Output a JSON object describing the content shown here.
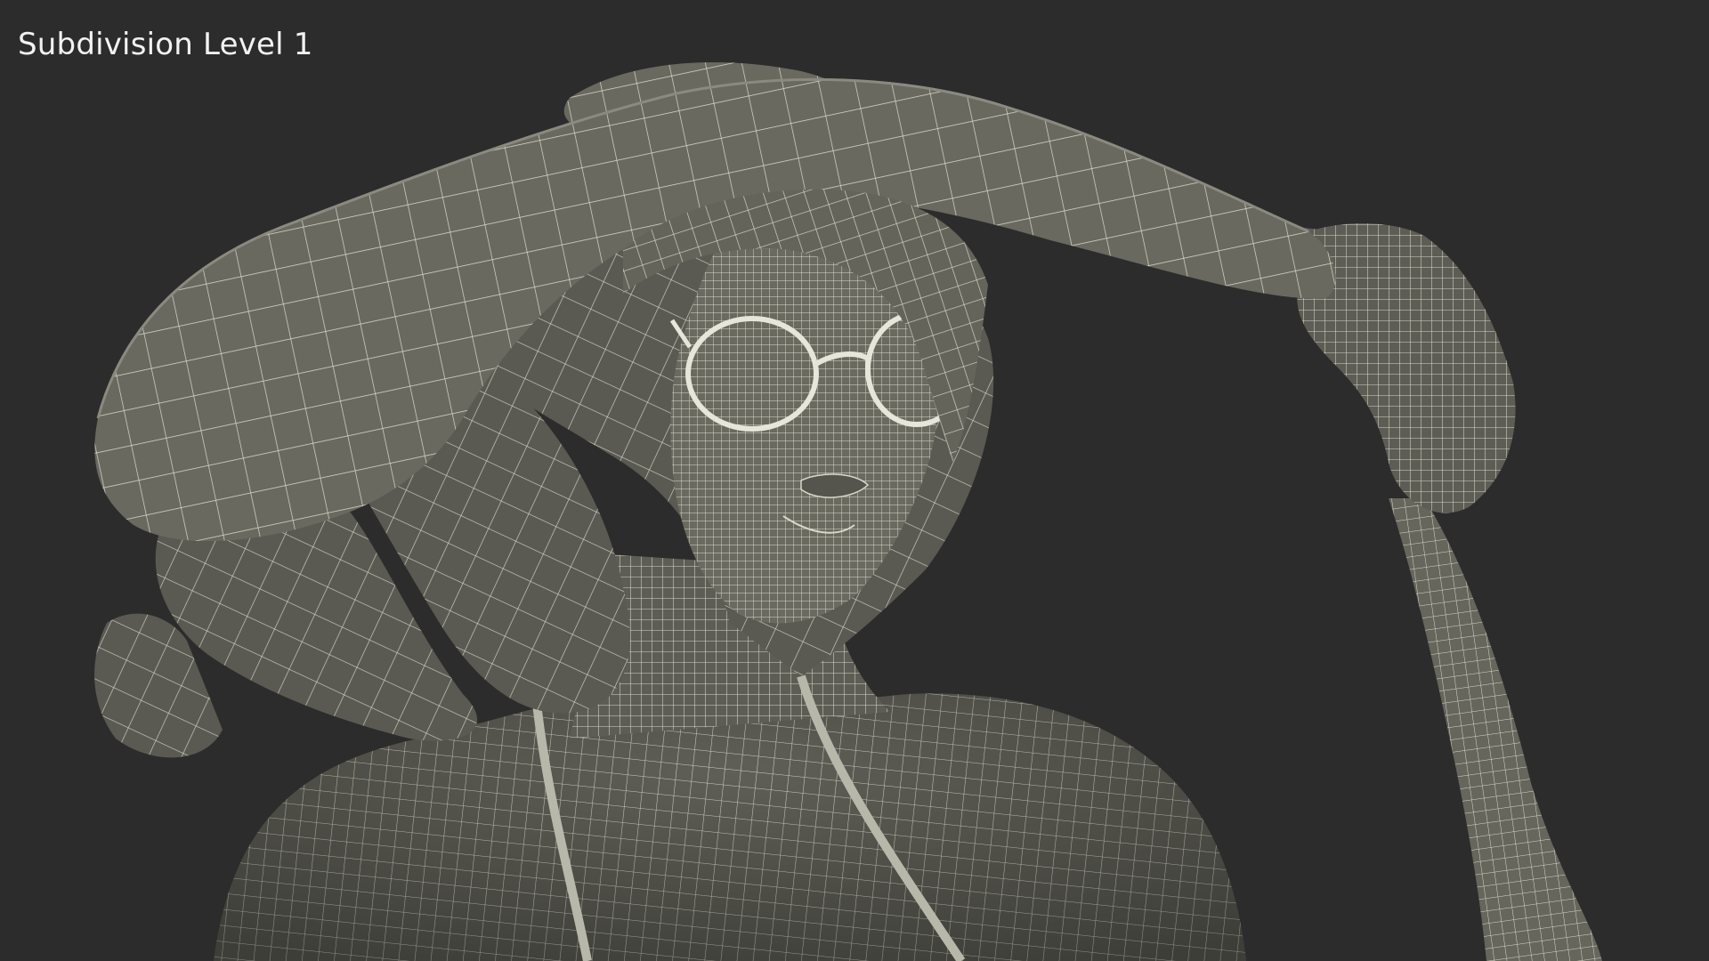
{
  "viewport": {
    "label": "Subdivision Level 1",
    "background_color": "#2c2c2c",
    "mesh_fill_color": "#5f5f56",
    "mesh_shadow_color": "#3d3d37",
    "wire_color": "#d8d8cc"
  },
  "scene": {
    "subject": "wireframe-woman-wide-brim-hat",
    "parts": [
      "hat-brim",
      "hat-crown",
      "hair",
      "face",
      "sunglasses",
      "neck",
      "shoulders",
      "raised-arm",
      "hand",
      "necklace-cord"
    ]
  }
}
